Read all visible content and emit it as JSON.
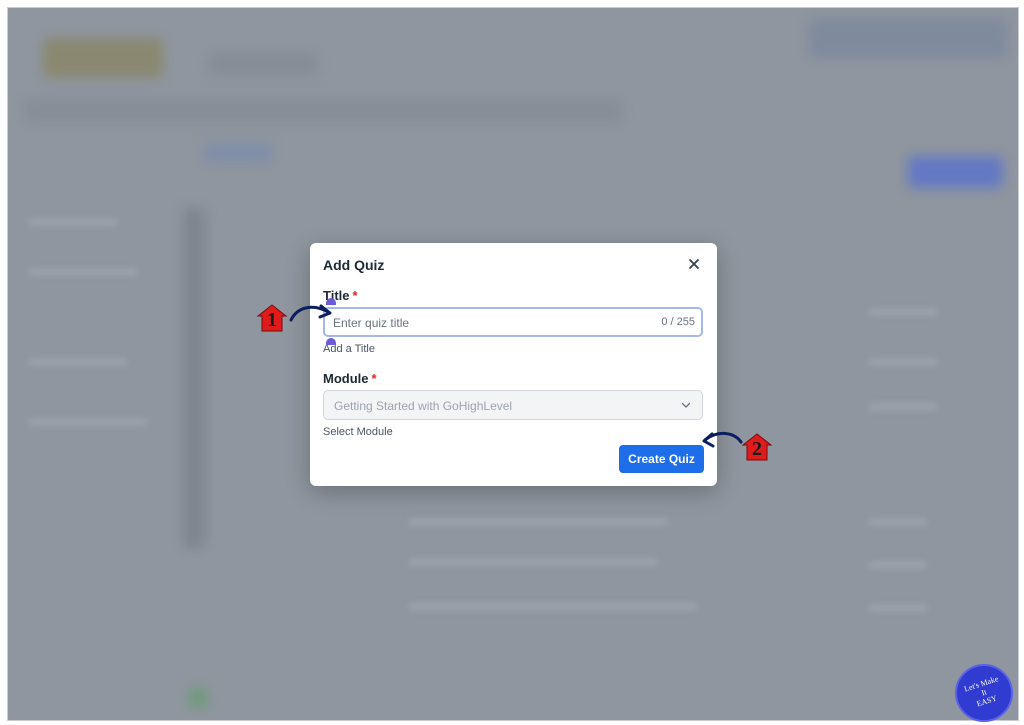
{
  "modal": {
    "title": "Add Quiz",
    "close_icon": "close-icon",
    "title_field": {
      "label": "Title",
      "required_mark": "*",
      "placeholder": "Enter quiz title",
      "value": "",
      "counter": "0 / 255",
      "helper": "Add a Title"
    },
    "module_field": {
      "label": "Module",
      "required_mark": "*",
      "selected": "Getting Started with GoHighLevel",
      "helper": "Select Module"
    },
    "create_button": "Create Quiz"
  },
  "annotations": {
    "step1": "1",
    "step2": "2",
    "marker_color": "#e01b1b",
    "arrow_color": "#0b1f5c"
  },
  "logo": {
    "line1": "Let's Make",
    "line2": "It",
    "line3": "EASY"
  },
  "colors": {
    "primary": "#1d6ee8",
    "overlay": "#8f969f",
    "required": "#dc2626"
  }
}
